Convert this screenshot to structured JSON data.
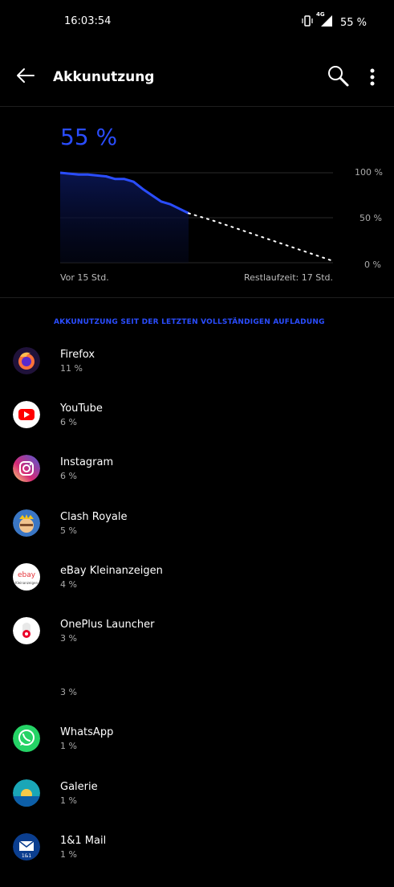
{
  "status_bar": {
    "time": "16:03:54",
    "battery": "55 %",
    "network": "4G"
  },
  "header": {
    "title": "Akkunutzung"
  },
  "summary": {
    "level": "55 %",
    "left_label": "Vor 15 Std.",
    "right_label": "Restlaufzeit: 17 Std."
  },
  "chart_data": {
    "type": "line",
    "y_ticks": [
      "100 %",
      "50 %",
      "0 %"
    ],
    "ylim": [
      0,
      100
    ],
    "grid": true,
    "series": [
      {
        "values": [
          100,
          99,
          98,
          98,
          97,
          96,
          93,
          93,
          90,
          82,
          75,
          68,
          65,
          60,
          55
        ]
      },
      {
        "values": [
          55,
          47,
          38,
          29,
          20,
          11,
          2
        ]
      }
    ]
  },
  "section_title": "AKKUNUTZUNG SEIT DER LETZTEN VOLLSTÄNDIGEN AUFLADUNG",
  "apps": [
    {
      "name": "Firefox",
      "percent": "11 %",
      "icon": "firefox-icon"
    },
    {
      "name": "YouTube",
      "percent": "6 %",
      "icon": "youtube-icon"
    },
    {
      "name": "Instagram",
      "percent": "6 %",
      "icon": "instagram-icon"
    },
    {
      "name": "Clash Royale",
      "percent": "5 %",
      "icon": "clash-royale-icon"
    },
    {
      "name": "eBay Kleinanzeigen",
      "percent": "4 %",
      "icon": "ebay-kleinanzeigen-icon",
      "icon_text": "ebay",
      "icon_subtext": "Kleinanzeigen"
    },
    {
      "name": "OnePlus Launcher",
      "percent": "3 %",
      "icon": "oneplus-launcher-icon"
    },
    {
      "name": "",
      "percent": "3 %",
      "icon": ""
    },
    {
      "name": "WhatsApp",
      "percent": "1 %",
      "icon": "whatsapp-icon"
    },
    {
      "name": "Galerie",
      "percent": "1 %",
      "icon": "gallery-icon"
    },
    {
      "name": "1&1 Mail",
      "percent": "1 %",
      "icon": "mail-icon",
      "icon_text": "1&1"
    }
  ],
  "colors": {
    "accent": "#2a4dff",
    "background": "#000000"
  }
}
